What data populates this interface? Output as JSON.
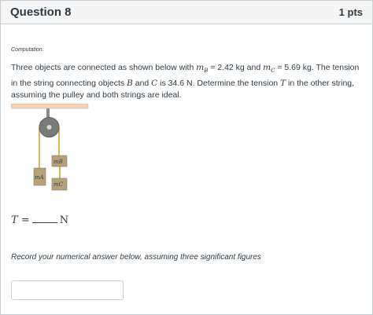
{
  "header": {
    "title": "Question 8",
    "points": "1 pts"
  },
  "question": {
    "type_label": "Computation.",
    "text": {
      "p1": "Three objects are connected as shown below with ",
      "mb_symbol": "m",
      "mb_sub": "B",
      "eq1": " = 2.42 kg and ",
      "mc_symbol": "m",
      "mc_sub": "C",
      "eq2": " = 5.69 kg. The tension in the string connecting objects ",
      "b": "B",
      "and": " and ",
      "c": "C",
      "p2": " is 34.6 N. Determine the tension ",
      "t": "T",
      "p3": " in the other string, assuming the pulley and both strings are ideal."
    },
    "diagram_labels": {
      "a": "mA",
      "b": "mB",
      "c": "mC"
    },
    "answer": {
      "variable": "T",
      "equals": "=",
      "unit": "N"
    },
    "instruction": "Record your numerical answer below, assuming three significant figures",
    "input_value": ""
  },
  "colors": {
    "header_bg": "#f5f5f5",
    "border": "#c7cdd1",
    "text": "#2d3b45",
    "ceiling": "#f4d3b6",
    "pulley": "#808080",
    "string": "#d4a017",
    "mass_fill": "#b5a27b"
  }
}
